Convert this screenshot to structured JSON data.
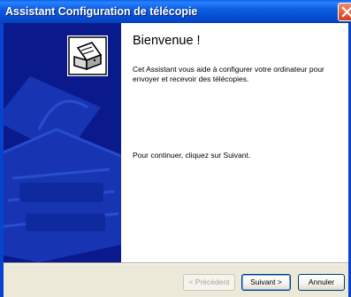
{
  "window": {
    "title": "Assistant Configuration de télécopie"
  },
  "side_panel": {
    "icon": "fax-printer-icon",
    "colors": {
      "background": "#0a1a8c",
      "accent": "#1c3fbf"
    }
  },
  "content": {
    "heading": "Bienvenue !",
    "intro": "Cet Assistant vous aide à configurer votre ordinateur pour envoyer et recevoir des télécopies.",
    "continue": "Pour continuer, cliquez sur Suivant."
  },
  "buttons": {
    "previous": "< Précédent",
    "next": "Suivant >",
    "cancel": "Annuler"
  },
  "colors": {
    "titlebar": "#0548cc",
    "frame": "#0843d0",
    "close": "#d6401c",
    "dialog_bg": "#ece9d8"
  }
}
